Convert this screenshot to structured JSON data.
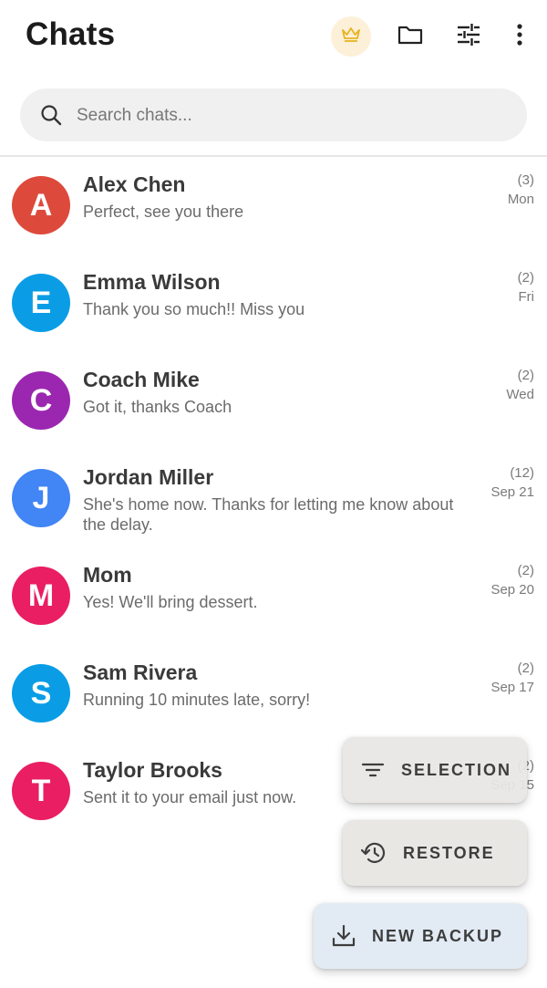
{
  "header": {
    "title": "Chats",
    "icons": [
      "crown-icon",
      "folder-icon",
      "tune-icon",
      "more-vert-icon"
    ],
    "crown_color": "#e6b422"
  },
  "search": {
    "placeholder": "Search chats..."
  },
  "chats": [
    {
      "initial": "A",
      "name": "Alex Chen",
      "message": "Perfect, see you there",
      "count": "(3)",
      "date": "Mon",
      "color": "#dd4a3c"
    },
    {
      "initial": "E",
      "name": "Emma Wilson",
      "message": "Thank you so much!! Miss you",
      "count": "(2)",
      "date": "Fri",
      "color": "#0a9de6"
    },
    {
      "initial": "C",
      "name": "Coach Mike",
      "message": "Got it, thanks Coach",
      "count": "(2)",
      "date": "Wed",
      "color": "#9b27b0"
    },
    {
      "initial": "J",
      "name": "Jordan Miller",
      "message": "She's home now. Thanks for letting me know about the delay.",
      "count": "(12)",
      "date": "Sep 21",
      "color": "#4285f4"
    },
    {
      "initial": "M",
      "name": "Mom",
      "message": "Yes! We'll bring dessert.",
      "count": "(2)",
      "date": "Sep 20",
      "color": "#e91e63"
    },
    {
      "initial": "S",
      "name": "Sam Rivera",
      "message": "Running 10 minutes late, sorry!",
      "count": "(2)",
      "date": "Sep 17",
      "color": "#0a9de6"
    },
    {
      "initial": "T",
      "name": "Taylor Brooks",
      "message": "Sent it to your email just now.",
      "count": "(2)",
      "date": "Sep 15",
      "color": "#e91e63"
    }
  ],
  "fabs": {
    "selection": "SELECTION",
    "restore": "RESTORE",
    "new_backup": "NEW BACKUP"
  }
}
